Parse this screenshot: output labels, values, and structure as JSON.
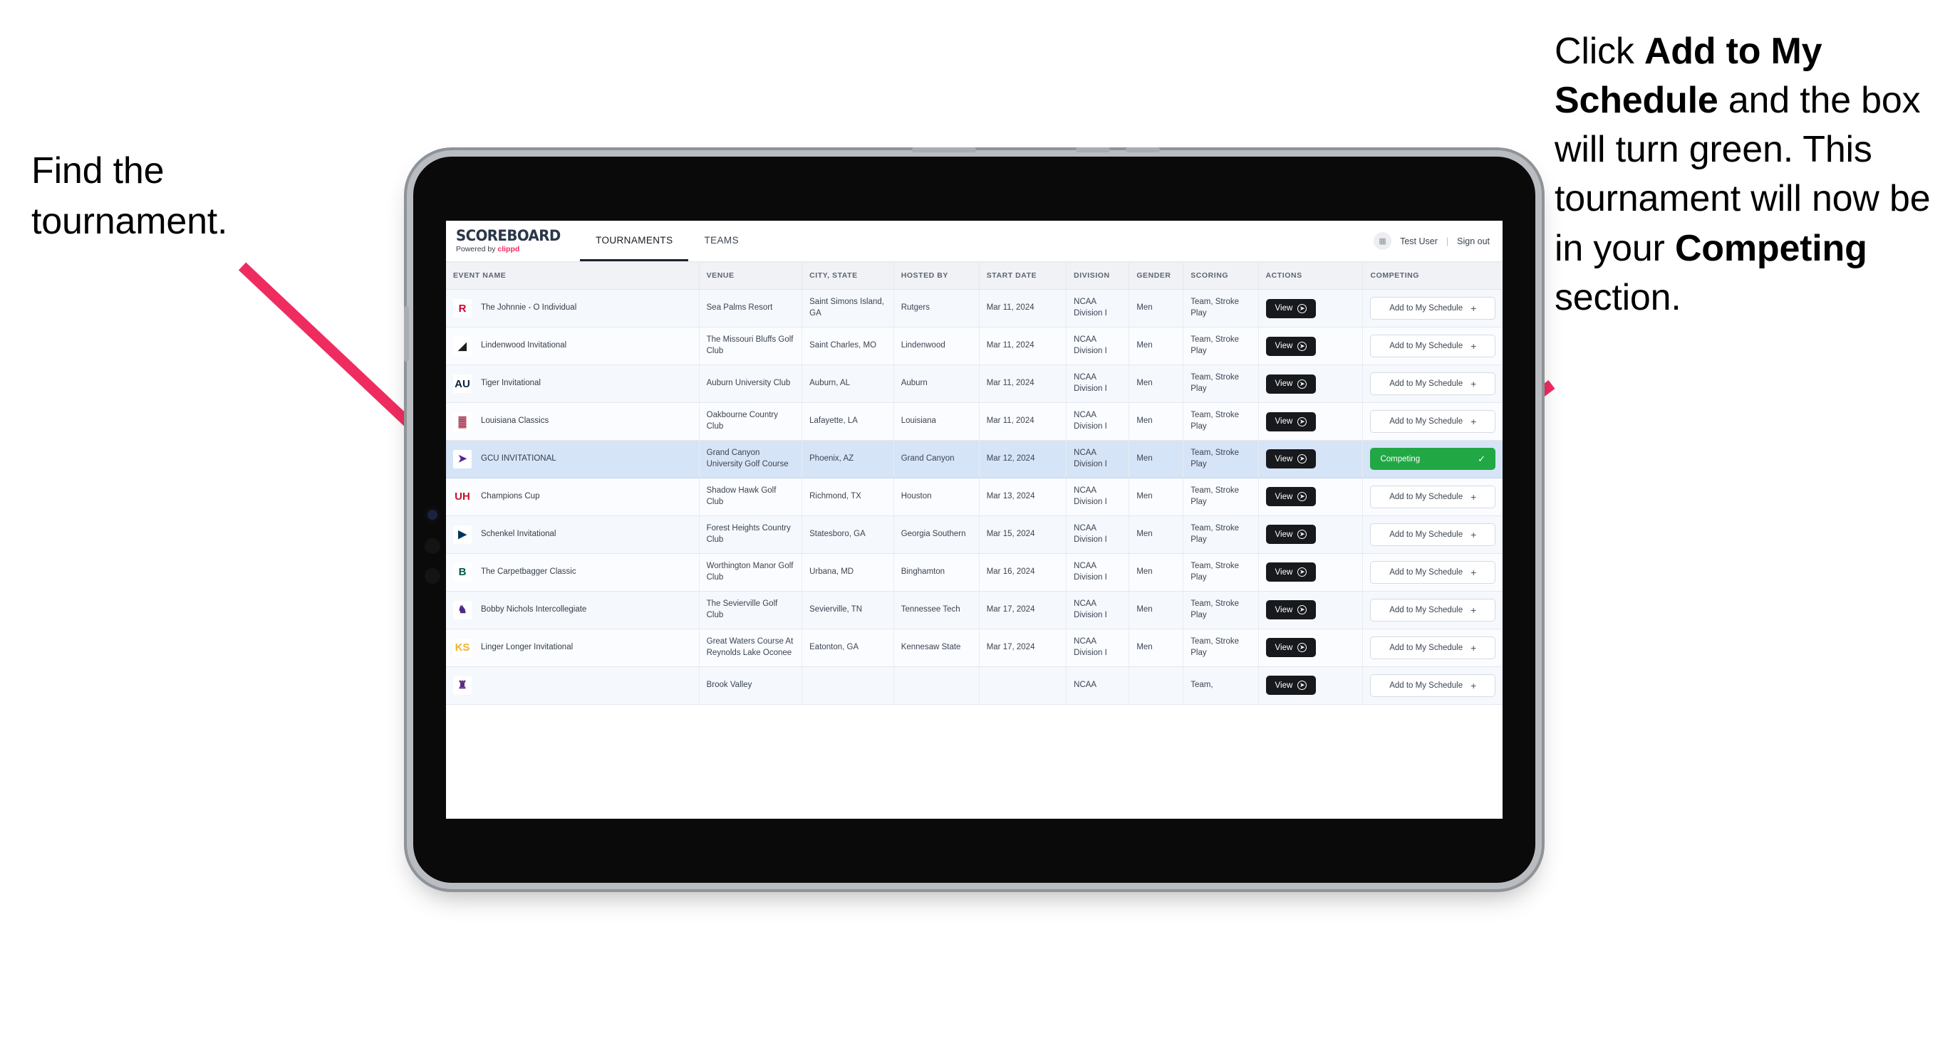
{
  "annotations": {
    "left": "Find the tournament.",
    "right": {
      "p1": "Click ",
      "b1": "Add to My Schedule",
      "p2": " and the box will turn green. This tournament will now be in your ",
      "b2": "Competing",
      "p3": " section."
    }
  },
  "app": {
    "brand_name": "SCOREBOARD",
    "brand_sub_prefix": "Powered by ",
    "brand_sub_clippd": "clippd",
    "tabs": [
      {
        "label": "TOURNAMENTS",
        "active": true
      },
      {
        "label": "TEAMS",
        "active": false
      }
    ],
    "user": {
      "avatar_icon": "user-avatar-icon",
      "name": "Test User",
      "separator": "|",
      "signout": "Sign out"
    }
  },
  "table": {
    "columns": [
      "EVENT NAME",
      "VENUE",
      "CITY, STATE",
      "HOSTED BY",
      "START DATE",
      "DIVISION",
      "GENDER",
      "SCORING",
      "ACTIONS",
      "COMPETING"
    ],
    "action_label": "View",
    "add_label": "Add to My Schedule",
    "add_icon": "plus-icon",
    "competing_label": "Competing",
    "competing_icon": "check-icon",
    "view_icon": "arrow-right-circle-icon",
    "rows": [
      {
        "logo": "R",
        "logo_bg": "#ffffff",
        "logo_color": "#cc0033",
        "event": "The Johnnie - O Individual",
        "venue": "Sea Palms Resort",
        "city": "Saint Simons Island, GA",
        "host": "Rutgers",
        "date": "Mar 11, 2024",
        "division": "NCAA Division I",
        "gender": "Men",
        "scoring": "Team, Stroke Play",
        "competing": false
      },
      {
        "logo": "◢",
        "logo_bg": "#ffffff",
        "logo_color": "#1d1d1d",
        "event": "Lindenwood Invitational",
        "venue": "The Missouri Bluffs Golf Club",
        "city": "Saint Charles, MO",
        "host": "Lindenwood",
        "date": "Mar 11, 2024",
        "division": "NCAA Division I",
        "gender": "Men",
        "scoring": "Team, Stroke Play",
        "competing": false
      },
      {
        "logo": "AU",
        "logo_bg": "#ffffff",
        "logo_color": "#0c2340",
        "event": "Tiger Invitational",
        "venue": "Auburn University Club",
        "city": "Auburn, AL",
        "host": "Auburn",
        "date": "Mar 11, 2024",
        "division": "NCAA Division I",
        "gender": "Men",
        "scoring": "Team, Stroke Play",
        "competing": false
      },
      {
        "logo": "▓",
        "logo_bg": "#ffffff",
        "logo_color": "#9b2743",
        "event": "Louisiana Classics",
        "venue": "Oakbourne Country Club",
        "city": "Lafayette, LA",
        "host": "Louisiana",
        "date": "Mar 11, 2024",
        "division": "NCAA Division I",
        "gender": "Men",
        "scoring": "Team, Stroke Play",
        "competing": false
      },
      {
        "logo": "➤",
        "logo_bg": "#ffffff",
        "logo_color": "#522398",
        "event": "GCU INVITATIONAL",
        "venue": "Grand Canyon University Golf Course",
        "city": "Phoenix, AZ",
        "host": "Grand Canyon",
        "date": "Mar 12, 2024",
        "division": "NCAA Division I",
        "gender": "Men",
        "scoring": "Team, Stroke Play",
        "competing": true
      },
      {
        "logo": "UH",
        "logo_bg": "#ffffff",
        "logo_color": "#c8102e",
        "event": "Champions Cup",
        "venue": "Shadow Hawk Golf Club",
        "city": "Richmond, TX",
        "host": "Houston",
        "date": "Mar 13, 2024",
        "division": "NCAA Division I",
        "gender": "Men",
        "scoring": "Team, Stroke Play",
        "competing": false
      },
      {
        "logo": "▶",
        "logo_bg": "#ffffff",
        "logo_color": "#00345b",
        "event": "Schenkel Invitational",
        "venue": "Forest Heights Country Club",
        "city": "Statesboro, GA",
        "host": "Georgia Southern",
        "date": "Mar 15, 2024",
        "division": "NCAA Division I",
        "gender": "Men",
        "scoring": "Team, Stroke Play",
        "competing": false
      },
      {
        "logo": "B",
        "logo_bg": "#ffffff",
        "logo_color": "#00594c",
        "event": "The Carpetbagger Classic",
        "venue": "Worthington Manor Golf Club",
        "city": "Urbana, MD",
        "host": "Binghamton",
        "date": "Mar 16, 2024",
        "division": "NCAA Division I",
        "gender": "Men",
        "scoring": "Team, Stroke Play",
        "competing": false
      },
      {
        "logo": "♞",
        "logo_bg": "#ffffff",
        "logo_color": "#4e2a84",
        "event": "Bobby Nichols Intercollegiate",
        "venue": "The Sevierville Golf Club",
        "city": "Sevierville, TN",
        "host": "Tennessee Tech",
        "date": "Mar 17, 2024",
        "division": "NCAA Division I",
        "gender": "Men",
        "scoring": "Team, Stroke Play",
        "competing": false
      },
      {
        "logo": "KS",
        "logo_bg": "#ffffff",
        "logo_color": "#f0b323",
        "event": "Linger Longer Invitational",
        "venue": "Great Waters Course At Reynolds Lake Oconee",
        "city": "Eatonton, GA",
        "host": "Kennesaw State",
        "date": "Mar 17, 2024",
        "division": "NCAA Division I",
        "gender": "Men",
        "scoring": "Team, Stroke Play",
        "competing": false
      },
      {
        "logo": "♜",
        "logo_bg": "#ffffff",
        "logo_color": "#5b2b82",
        "event": "",
        "venue": "Brook Valley",
        "city": "",
        "host": "",
        "date": "",
        "division": "NCAA",
        "gender": "",
        "scoring": "Team,",
        "competing": false,
        "cut_off": true
      }
    ]
  },
  "colors": {
    "arrow": "#ef2c60",
    "competing_green": "#22a745",
    "selected_row": "#d6e4f7",
    "brand_accent": "#f4285e"
  }
}
